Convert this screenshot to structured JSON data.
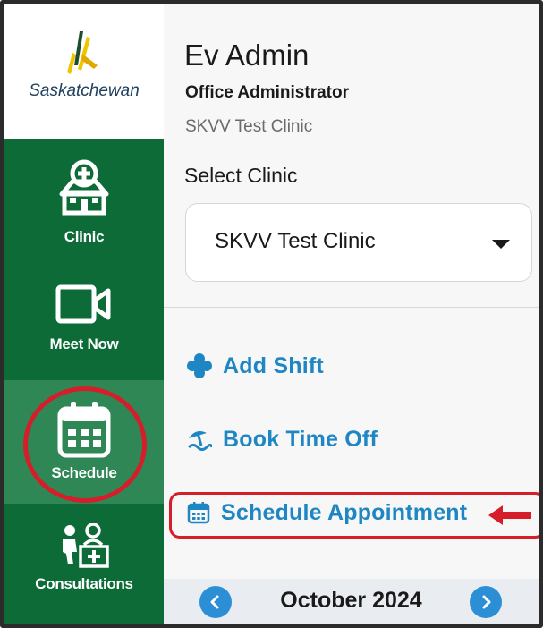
{
  "sidebar": {
    "logo_text": "Saskatchewan",
    "items": [
      {
        "label": "Clinic",
        "icon": "clinic-icon"
      },
      {
        "label": "Meet Now",
        "icon": "video-camera-icon"
      },
      {
        "label": "Schedule",
        "icon": "calendar-icon",
        "active": true
      },
      {
        "label": "Consultations",
        "icon": "consultation-icon"
      }
    ]
  },
  "user": {
    "name": "Ev Admin",
    "role": "Office Administrator",
    "clinic": "SKVV Test Clinic"
  },
  "clinic_select": {
    "label": "Select Clinic",
    "value": "SKVV Test Clinic"
  },
  "actions": [
    {
      "label": "Add Shift",
      "icon": "plus-icon"
    },
    {
      "label": "Book Time Off",
      "icon": "beach-icon"
    },
    {
      "label": "Schedule Appointment",
      "icon": "calendar-icon"
    }
  ],
  "calendar": {
    "month": "October 2024"
  },
  "colors": {
    "sidebar_green": "#0d6b38",
    "active_green": "#2f8755",
    "accent_blue": "#1f86c4",
    "highlight_red": "#d51e2a"
  }
}
